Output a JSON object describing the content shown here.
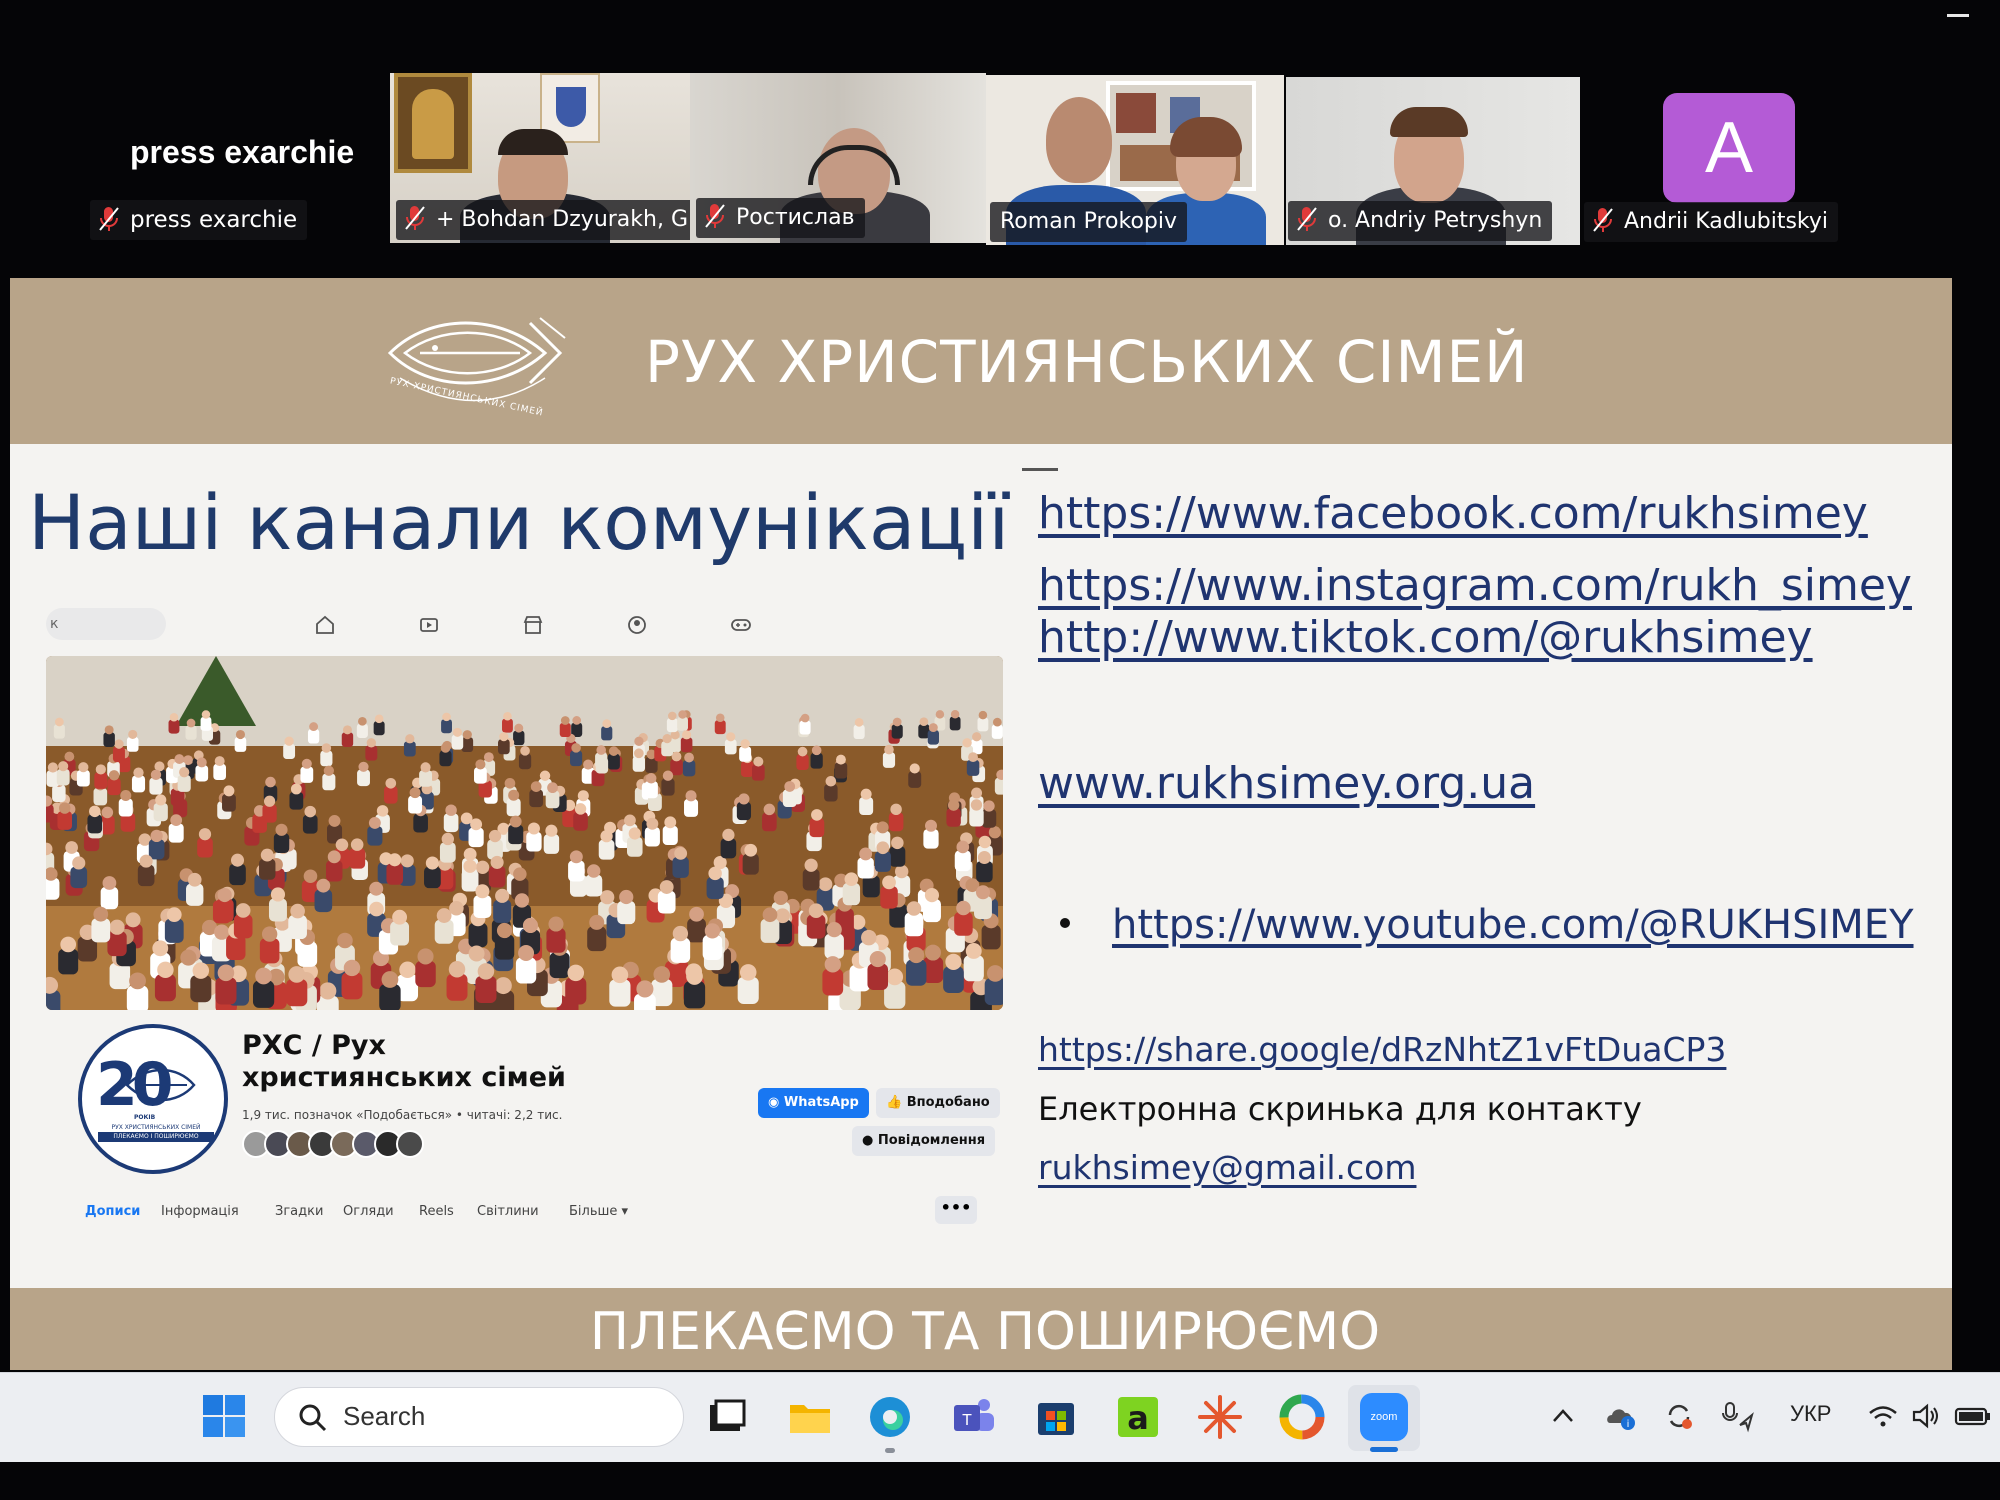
{
  "zoom": {
    "self_view": {
      "display_name": "press exarchie",
      "name_tag": "press exarchie"
    },
    "participants": [
      {
        "name": "+ Bohdan Dzyurakh, G...",
        "muted": true
      },
      {
        "name": "Ростислав",
        "muted": true
      },
      {
        "name": "Roman Prokopiv",
        "muted": false,
        "active_speaker": true
      },
      {
        "name": "o. Andriy Petryshyn",
        "muted": true
      },
      {
        "name": "Andrii Kadlubitskyi",
        "muted": true,
        "avatar_letter": "A",
        "avatar_color": "#b45bd6"
      }
    ]
  },
  "slide": {
    "header_title": "РУХ ХРИСТИЯНСЬКИХ СІМЕЙ",
    "logo_text": "РУХ ХРИСТИЯНСЬКИХ СІМЕЙ",
    "heading": "Наші канали комунікації",
    "links": {
      "facebook": "https://www.facebook.com/rukhsimey",
      "instagram": "https://www.instagram.com/rukh_simey",
      "tiktok": "http://www.tiktok.com/@rukhsimey",
      "website": "www.rukhsimey.org.ua",
      "youtube": "https://www.youtube.com/@RUKHSIMEY",
      "google_share": "https://share.google/dRzNhtZ1vFtDuaCP3"
    },
    "contact_label": "Електронна скринька для контакту",
    "contact_email": "rukhsimey@gmail.com",
    "footer_tagline": "ПЛЕКАЄМО ТА ПОШИРЮЄМО",
    "colors": {
      "band": "#b8a489",
      "heading": "#1f3a6b",
      "link": "#1f3470",
      "background": "#f4f3f1"
    }
  },
  "facebook_page": {
    "search_fragment": "к",
    "page_name": "РХС / Рух християнських сімей",
    "meta": "1,9 тис. позначок «Подобається» • читачі: 2,2 тис.",
    "profile_badge": {
      "number": "20",
      "label": "РОКІВ",
      "subtitle": "РУХ ХРИСТИЯНСЬКИХ СІМЕЙ",
      "slogan": "ПЛЕКАЄМО І ПОШИРЮЄМО"
    },
    "buttons": {
      "whatsapp": "WhatsApp",
      "liked": "Вподобано",
      "message": "Повідомлення"
    },
    "tabs": [
      "Дописи",
      "Інформація",
      "Згадки",
      "Огляди",
      "Reels",
      "Світлини",
      "Більше ▾"
    ],
    "more_button": "•••"
  },
  "taskbar": {
    "search_placeholder": "Search",
    "language": "УКР",
    "pinned_apps": [
      "task-view",
      "file-explorer",
      "edge",
      "teams",
      "microsoft-store",
      "app-green",
      "app-starburst",
      "app-color-ring",
      "zoom"
    ],
    "zoom_label": "zoom"
  }
}
